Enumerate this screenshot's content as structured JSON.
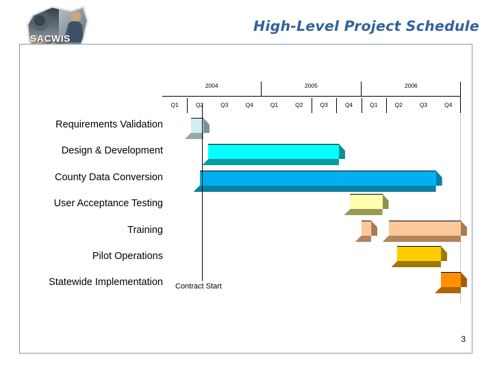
{
  "slide": {
    "title": "High-Level Project Schedule",
    "page_number": "3",
    "logo_text": "SACWIS",
    "frame_border_color": "#7f99b2",
    "title_color": "#31639c"
  },
  "chart_data": {
    "type": "bar",
    "chart_kind": "gantt",
    "title": "High-Level Project Schedule",
    "xlabel": "",
    "ylabel": "",
    "grid": false,
    "legend_position": "none",
    "annotations": [
      {
        "label": "Contract Start",
        "x": "2004-Q2",
        "type": "vertical-line"
      }
    ],
    "years": [
      {
        "label": "2004",
        "quarters": [
          "Q1",
          "Q2",
          "Q3",
          "Q4"
        ]
      },
      {
        "label": "2005",
        "quarters": [
          "Q1",
          "Q2",
          "Q3",
          "Q4"
        ]
      },
      {
        "label": "2006",
        "quarters": [
          "Q1",
          "Q2",
          "Q3",
          "Q4"
        ]
      }
    ],
    "quarter_ticks": [
      "Q1",
      "Q2",
      "Q3",
      "Q4",
      "Q1",
      "Q2",
      "Q3",
      "Q4",
      "Q1",
      "Q2",
      "Q3",
      "Q4"
    ],
    "categories": [
      "Requirements Validation",
      "Design & Development",
      "County Data Conversion",
      "User Acceptance Testing",
      "Training",
      "Pilot Operations",
      "Statewide Implementation"
    ],
    "tasks": [
      {
        "name": "Requirements Validation",
        "bars": [
          {
            "start_quarter": 1.15,
            "end_quarter": 1.65,
            "start_label": "2004-Q2",
            "end_label": "2004-Q2",
            "color": "#cdeef2",
            "side_color": "#7f9193",
            "bottom_color": "#99a8aa"
          }
        ]
      },
      {
        "name": "Design & Development",
        "bars": [
          {
            "start_quarter": 1.85,
            "end_quarter": 7.1,
            "start_label": "2004-Q3",
            "end_label": "2005-Q4",
            "color": "#00ffff",
            "side_color": "#0b8f92",
            "bottom_color": "#0a9c9e"
          }
        ]
      },
      {
        "name": "County Data Conversion",
        "bars": [
          {
            "start_quarter": 1.5,
            "end_quarter": 11.0,
            "start_label": "2004-Q2",
            "end_label": "2006-Q4",
            "color": "#00b0f0",
            "side_color": "#0281ab",
            "bottom_color": "#0a7fa2"
          }
        ]
      },
      {
        "name": "User Acceptance Testing",
        "bars": [
          {
            "start_quarter": 7.55,
            "end_quarter": 8.85,
            "start_label": "2006-Q1",
            "end_label": "2006-Q1",
            "color": "#ffffaf",
            "side_color": "#8f8f4e",
            "bottom_color": "#9a9a54"
          }
        ]
      },
      {
        "name": "Training",
        "bars": [
          {
            "start_quarter": 8.0,
            "end_quarter": 8.4,
            "start_label": "2006-Q1",
            "end_label": "2006-Q1",
            "color": "#fcc89b",
            "side_color": "#a87a50",
            "bottom_color": "#b4835a"
          },
          {
            "start_quarter": 9.1,
            "end_quarter": 12.0,
            "start_label": "2006-Q2",
            "end_label": "2006-Q4",
            "color": "#fcc89b",
            "side_color": "#a87a50",
            "bottom_color": "#b4835a"
          }
        ]
      },
      {
        "name": "Pilot Operations",
        "bars": [
          {
            "start_quarter": 9.45,
            "end_quarter": 11.2,
            "start_label": "2006-Q3",
            "end_label": "2006-Q4",
            "color": "#ffcc00",
            "side_color": "#9c7a00",
            "bottom_color": "#9c7a00"
          }
        ]
      },
      {
        "name": "Statewide Implementation",
        "bars": [
          {
            "start_quarter": 11.2,
            "end_quarter": 12.0,
            "start_label": "2006-Q4",
            "end_label": "2006-Q4",
            "color": "#ff9000",
            "side_color": "#a35d07",
            "bottom_color": "#ad6608"
          }
        ]
      }
    ]
  }
}
